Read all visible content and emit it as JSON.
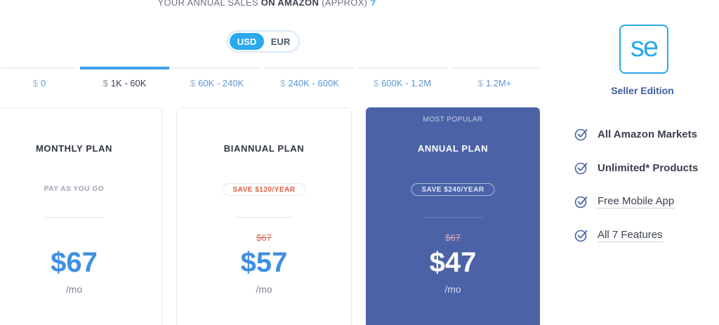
{
  "headline": {
    "part1": "YOUR ANNUAL SALES ",
    "bold": "ON AMAZON",
    "part2": " (APPROX) ",
    "help": "?"
  },
  "currency": {
    "options": [
      "USD",
      "EUR"
    ],
    "selected": "USD"
  },
  "sales_tiers": [
    {
      "currency_symbol": "$",
      "label": "0",
      "active": false
    },
    {
      "currency_symbol": "$",
      "label": "1K - 60K",
      "active": true
    },
    {
      "currency_symbol": "$",
      "label": "60K - 240K",
      "active": false
    },
    {
      "currency_symbol": "$",
      "label": "240K - 600K",
      "active": false
    },
    {
      "currency_symbol": "$",
      "label": "600K - 1.2M",
      "active": false
    },
    {
      "currency_symbol": "$",
      "label": "1.2M+",
      "active": false
    }
  ],
  "plans": [
    {
      "name": "MONTHLY PLAN",
      "subtitle": "PAY AS YOU GO",
      "price": "$67",
      "period": "/mo"
    },
    {
      "name": "BIANNUAL PLAN",
      "save_badge": "SAVE $120/YEAR",
      "old_price": "$67",
      "price": "$57",
      "period": "/mo"
    },
    {
      "badge": "MOST POPULAR",
      "name": "ANNUAL PLAN",
      "save_badge": "SAVE $240/YEAR",
      "old_price": "$67",
      "price": "$47",
      "period": "/mo"
    }
  ],
  "product": {
    "logo_text": "se",
    "edition": "Seller Edition",
    "features": [
      {
        "label": "All Amazon Markets",
        "style": "bold"
      },
      {
        "label": "Unlimited* Products",
        "style": "bold"
      },
      {
        "label": "Free Mobile App",
        "style": "dotted"
      },
      {
        "label": "All 7 Features",
        "style": "dotted"
      }
    ]
  },
  "colors": {
    "accent": "#2aa9ee",
    "popular_card": "#4b63a6",
    "price_blue": "#3f8fe3",
    "save_red": "#e05a3a",
    "edition_blue": "#3e5aa2"
  },
  "icons": {
    "feature_check": "circle-check-icon"
  }
}
